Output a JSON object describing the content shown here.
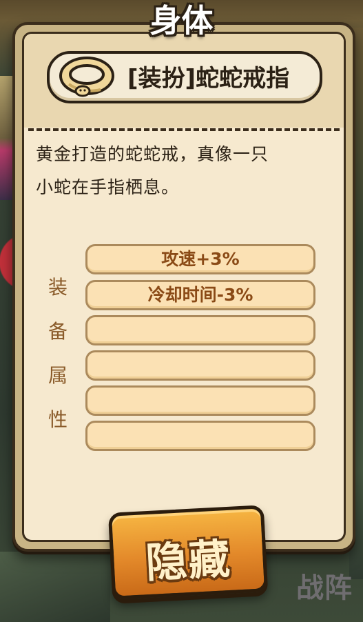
{
  "title": "身体",
  "item": {
    "name": "[装扮]蛇蛇戒指",
    "icon": "snake-ring-icon",
    "description_lines": [
      "黄金打造的蛇蛇戒，真像一只",
      "小蛇在手指栖息。"
    ]
  },
  "attributes": {
    "label_chars": [
      "装",
      "备",
      "属",
      "性"
    ],
    "slots": [
      "攻速+3%",
      "冷却时间-3%",
      "",
      "",
      "",
      ""
    ]
  },
  "hide_button": {
    "label": "隐藏"
  },
  "background": {
    "bottom_text": "战阵"
  },
  "colors": {
    "panel": "#c8b485",
    "panel_inner": "#f6e9cf",
    "slot_fill": "#fbe1b4",
    "button_orange": "#e3892a",
    "outline": "#2b2115"
  }
}
